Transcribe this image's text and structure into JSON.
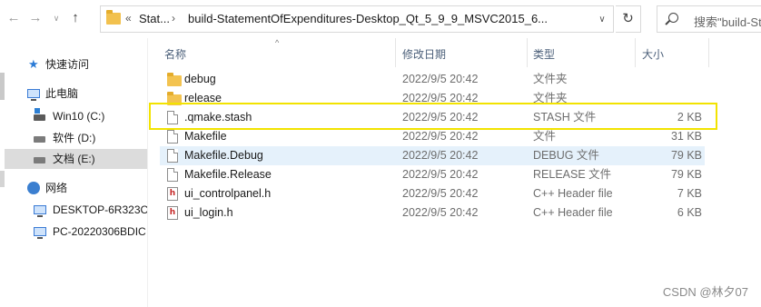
{
  "nav": {
    "back_icon": "arrow-left-icon",
    "forward_icon": "arrow-right-icon",
    "recent_icon": "chevron-down-icon",
    "up_icon": "arrow-up-icon"
  },
  "address": {
    "overflow": "«",
    "crumbs": [
      "Stat...",
      "build-StatementOfExpenditures-Desktop_Qt_5_9_9_MSVC2015_6..."
    ],
    "refresh_icon": "refresh-icon"
  },
  "search": {
    "placeholder": "搜索\"build-St"
  },
  "sidebar": {
    "quick_access": "快速访问",
    "this_pc": "此电脑",
    "drives": [
      "Win10 (C:)",
      "软件 (D:)",
      "文档 (E:)"
    ],
    "network": "网络",
    "computers": [
      "DESKTOP-6R323C",
      "PC-20220306BDIC"
    ]
  },
  "columns": {
    "name": "名称",
    "date": "修改日期",
    "type": "类型",
    "size": "大小"
  },
  "files": [
    {
      "name": "debug",
      "date": "2022/9/5 20:42",
      "type": "文件夹",
      "size": "",
      "icon": "folder-icon"
    },
    {
      "name": "release",
      "date": "2022/9/5 20:42",
      "type": "文件夹",
      "size": "",
      "icon": "folder-icon"
    },
    {
      "name": ".qmake.stash",
      "date": "2022/9/5 20:42",
      "type": "STASH 文件",
      "size": "2 KB",
      "icon": "file-icon"
    },
    {
      "name": "Makefile",
      "date": "2022/9/5 20:42",
      "type": "文件",
      "size": "31 KB",
      "icon": "file-icon"
    },
    {
      "name": "Makefile.Debug",
      "date": "2022/9/5 20:42",
      "type": "DEBUG 文件",
      "size": "79 KB",
      "icon": "file-icon"
    },
    {
      "name": "Makefile.Release",
      "date": "2022/9/5 20:42",
      "type": "RELEASE 文件",
      "size": "79 KB",
      "icon": "file-icon"
    },
    {
      "name": "ui_controlpanel.h",
      "date": "2022/9/5 20:42",
      "type": "C++ Header file",
      "size": "7 KB",
      "icon": "header-file-icon"
    },
    {
      "name": "ui_login.h",
      "date": "2022/9/5 20:42",
      "type": "C++ Header file",
      "size": "6 KB",
      "icon": "header-file-icon"
    }
  ],
  "watermark": "CSDN @林夕07",
  "colors": {
    "highlight_box": "#f2e300",
    "hover_row": "#e5f1fb",
    "selected_sidebar": "#dcdcdc"
  }
}
